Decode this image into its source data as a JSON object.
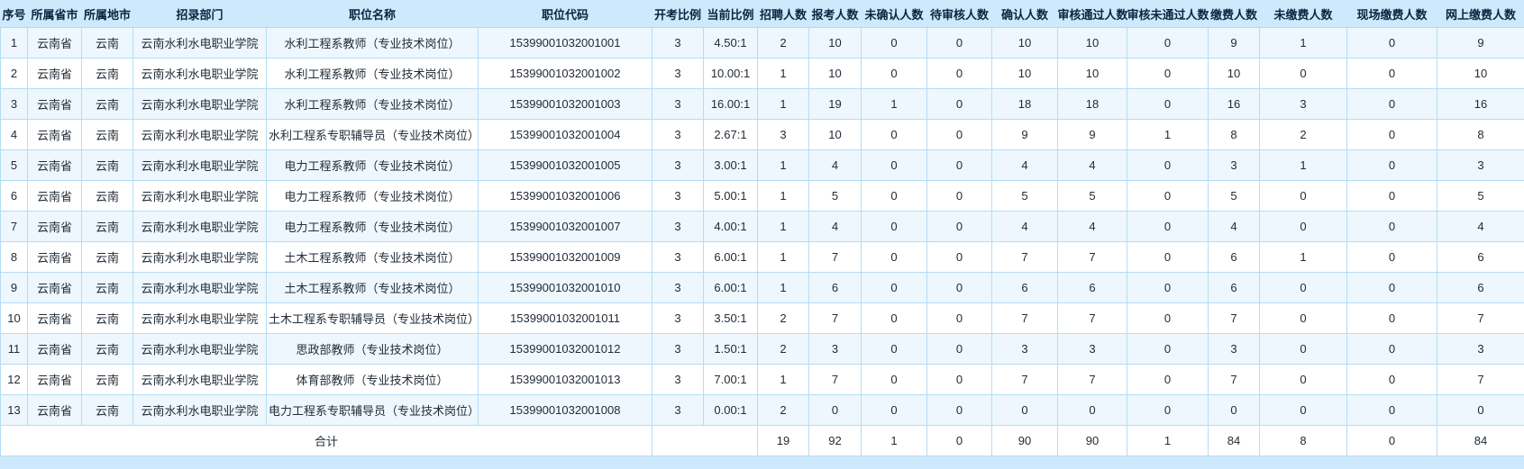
{
  "page": {
    "background": "#cde9fb"
  },
  "table": {
    "colors": {
      "page_bg": "#cde9fb",
      "border": "#b5ddf4",
      "row_odd_bg": "#eef7fd",
      "row_even_bg": "#ffffff",
      "header_text": "#0d2440",
      "body_text": "#232c36"
    },
    "columns": [
      {
        "id": "xuhao",
        "label": "序号"
      },
      {
        "id": "province",
        "label": "所属省市"
      },
      {
        "id": "city",
        "label": "所属地市"
      },
      {
        "id": "department",
        "label": "招录部门"
      },
      {
        "id": "position-name",
        "label": "职位名称"
      },
      {
        "id": "position-code",
        "label": "职位代码"
      },
      {
        "id": "open-ratio",
        "label": "开考比例"
      },
      {
        "id": "current-ratio",
        "label": "当前比例"
      },
      {
        "id": "recruit-count",
        "label": "招聘人数"
      },
      {
        "id": "apply-count",
        "label": "报考人数"
      },
      {
        "id": "unconfirmed-count",
        "label": "未确认人数"
      },
      {
        "id": "pending-review-count",
        "label": "待审核人数"
      },
      {
        "id": "confirmed-count",
        "label": "确认人数"
      },
      {
        "id": "review-passed-count",
        "label": "审核通过人数"
      },
      {
        "id": "review-failed-count",
        "label": "审核未通过人数"
      },
      {
        "id": "paid-count",
        "label": "缴费人数"
      },
      {
        "id": "unpaid-count",
        "label": "未缴费人数"
      },
      {
        "id": "onsite-paid-count",
        "label": "现场缴费人数"
      },
      {
        "id": "online-paid-count",
        "label": "网上缴费人数"
      }
    ],
    "rows": [
      [
        "1",
        "云南省",
        "云南",
        "云南水利水电职业学院",
        "水利工程系教师（专业技术岗位）",
        "15399001032001001",
        "3",
        "4.50:1",
        "2",
        "10",
        "0",
        "0",
        "10",
        "10",
        "0",
        "9",
        "1",
        "0",
        "9"
      ],
      [
        "2",
        "云南省",
        "云南",
        "云南水利水电职业学院",
        "水利工程系教师（专业技术岗位）",
        "15399001032001002",
        "3",
        "10.00:1",
        "1",
        "10",
        "0",
        "0",
        "10",
        "10",
        "0",
        "10",
        "0",
        "0",
        "10"
      ],
      [
        "3",
        "云南省",
        "云南",
        "云南水利水电职业学院",
        "水利工程系教师（专业技术岗位）",
        "15399001032001003",
        "3",
        "16.00:1",
        "1",
        "19",
        "1",
        "0",
        "18",
        "18",
        "0",
        "16",
        "3",
        "0",
        "16"
      ],
      [
        "4",
        "云南省",
        "云南",
        "云南水利水电职业学院",
        "水利工程系专职辅导员（专业技术岗位）",
        "15399001032001004",
        "3",
        "2.67:1",
        "3",
        "10",
        "0",
        "0",
        "9",
        "9",
        "1",
        "8",
        "2",
        "0",
        "8"
      ],
      [
        "5",
        "云南省",
        "云南",
        "云南水利水电职业学院",
        "电力工程系教师（专业技术岗位）",
        "15399001032001005",
        "3",
        "3.00:1",
        "1",
        "4",
        "0",
        "0",
        "4",
        "4",
        "0",
        "3",
        "1",
        "0",
        "3"
      ],
      [
        "6",
        "云南省",
        "云南",
        "云南水利水电职业学院",
        "电力工程系教师（专业技术岗位）",
        "15399001032001006",
        "3",
        "5.00:1",
        "1",
        "5",
        "0",
        "0",
        "5",
        "5",
        "0",
        "5",
        "0",
        "0",
        "5"
      ],
      [
        "7",
        "云南省",
        "云南",
        "云南水利水电职业学院",
        "电力工程系教师（专业技术岗位）",
        "15399001032001007",
        "3",
        "4.00:1",
        "1",
        "4",
        "0",
        "0",
        "4",
        "4",
        "0",
        "4",
        "0",
        "0",
        "4"
      ],
      [
        "8",
        "云南省",
        "云南",
        "云南水利水电职业学院",
        "土木工程系教师（专业技术岗位）",
        "15399001032001009",
        "3",
        "6.00:1",
        "1",
        "7",
        "0",
        "0",
        "7",
        "7",
        "0",
        "6",
        "1",
        "0",
        "6"
      ],
      [
        "9",
        "云南省",
        "云南",
        "云南水利水电职业学院",
        "土木工程系教师（专业技术岗位）",
        "15399001032001010",
        "3",
        "6.00:1",
        "1",
        "6",
        "0",
        "0",
        "6",
        "6",
        "0",
        "6",
        "0",
        "0",
        "6"
      ],
      [
        "10",
        "云南省",
        "云南",
        "云南水利水电职业学院",
        "土木工程系专职辅导员（专业技术岗位）",
        "15399001032001011",
        "3",
        "3.50:1",
        "2",
        "7",
        "0",
        "0",
        "7",
        "7",
        "0",
        "7",
        "0",
        "0",
        "7"
      ],
      [
        "11",
        "云南省",
        "云南",
        "云南水利水电职业学院",
        "思政部教师（专业技术岗位）",
        "15399001032001012",
        "3",
        "1.50:1",
        "2",
        "3",
        "0",
        "0",
        "3",
        "3",
        "0",
        "3",
        "0",
        "0",
        "3"
      ],
      [
        "12",
        "云南省",
        "云南",
        "云南水利水电职业学院",
        "体育部教师（专业技术岗位）",
        "15399001032001013",
        "3",
        "7.00:1",
        "1",
        "7",
        "0",
        "0",
        "7",
        "7",
        "0",
        "7",
        "0",
        "0",
        "7"
      ],
      [
        "13",
        "云南省",
        "云南",
        "云南水利水电职业学院",
        "电力工程系专职辅导员（专业技术岗位）",
        "15399001032001008",
        "3",
        "0.00:1",
        "2",
        "0",
        "0",
        "0",
        "0",
        "0",
        "0",
        "0",
        "0",
        "0",
        "0"
      ]
    ],
    "total": {
      "label": "合计",
      "label_span": 6,
      "empty_span": 2,
      "values": [
        "19",
        "92",
        "1",
        "0",
        "90",
        "90",
        "1",
        "84",
        "8",
        "0",
        "84"
      ]
    }
  }
}
